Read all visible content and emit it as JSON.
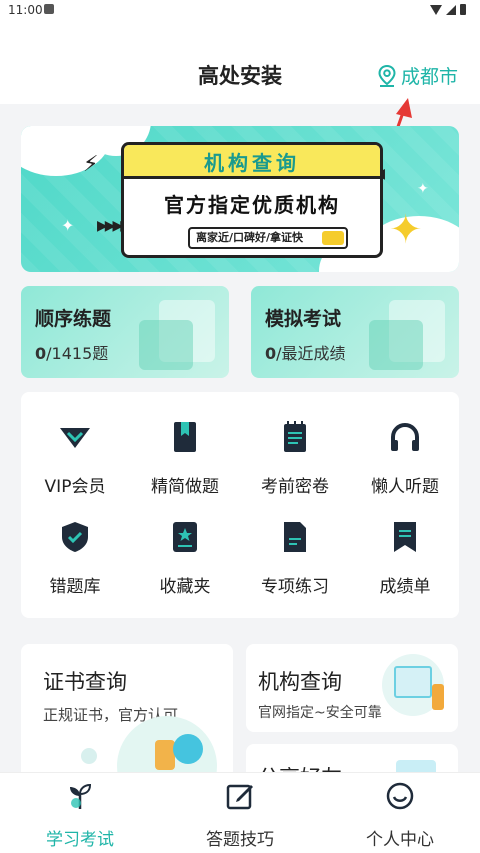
{
  "status_bar": {
    "time": "11:00"
  },
  "header": {
    "title": "高处安装",
    "location": "成都市"
  },
  "banner": {
    "title": "机构查询",
    "subtitle": "官方指定优质机构",
    "tagline": "离家近/口碑好/拿证快"
  },
  "quick_cards": [
    {
      "title": "顺序练题",
      "count": "0",
      "rest": "/1415题"
    },
    {
      "title": "模拟考试",
      "count": "0",
      "rest": "/最近成绩"
    }
  ],
  "grid_items": [
    {
      "label": "VIP会员",
      "icon": "vip-diamond-icon"
    },
    {
      "label": "精简做题",
      "icon": "bookmark-book-icon"
    },
    {
      "label": "考前密卷",
      "icon": "notepad-icon"
    },
    {
      "label": "懒人听题",
      "icon": "headphones-icon"
    },
    {
      "label": "错题库",
      "icon": "shield-check-icon"
    },
    {
      "label": "收藏夹",
      "icon": "star-folder-icon"
    },
    {
      "label": "专项练习",
      "icon": "document-icon"
    },
    {
      "label": "成绩单",
      "icon": "ribbon-icon"
    }
  ],
  "bottom_cards": {
    "cert": {
      "title": "证书查询",
      "subtitle": "正规证书，官方认可"
    },
    "inst": {
      "title": "机构查询",
      "subtitle": "官网指定~安全可靠"
    },
    "share": {
      "title": "分享好友"
    }
  },
  "tabs": [
    {
      "label": "学习考试",
      "icon": "sprout-icon",
      "active": true
    },
    {
      "label": "答题技巧",
      "icon": "edit-icon",
      "active": false
    },
    {
      "label": "个人中心",
      "icon": "smile-icon",
      "active": false
    }
  ],
  "colors": {
    "accent": "#1fb5a8",
    "dark": "#1f2b3a",
    "banner": "#4fd8c8"
  }
}
